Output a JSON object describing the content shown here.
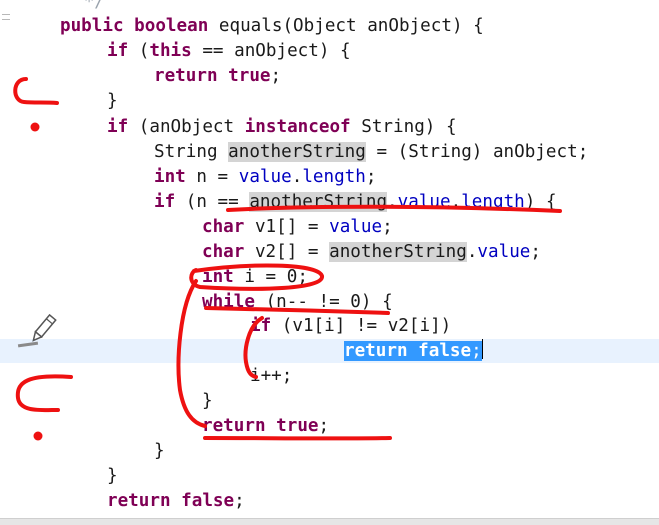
{
  "editor": {
    "top_fragment": "*/",
    "lines": [
      {
        "tokens": [
          {
            "t": "public ",
            "c": "kw"
          },
          {
            "t": "boolean ",
            "c": "kw"
          },
          {
            "t": "equals(Object anObject) {"
          }
        ]
      },
      {
        "tokens": [
          {
            "t": "if ",
            "c": "kw"
          },
          {
            "t": "("
          },
          {
            "t": "this",
            "c": "kw"
          },
          {
            "t": " == anObject) {"
          }
        ]
      },
      {
        "tokens": [
          {
            "t": "return ",
            "c": "kw"
          },
          {
            "t": "true",
            "c": "kw"
          },
          {
            "t": ";"
          }
        ]
      },
      {
        "tokens": [
          {
            "t": "}"
          }
        ]
      },
      {
        "tokens": [
          {
            "t": "if ",
            "c": "kw"
          },
          {
            "t": "(anObject "
          },
          {
            "t": "instanceof",
            "c": "kw"
          },
          {
            "t": " String) {"
          }
        ]
      },
      {
        "tokens": [
          {
            "t": "String "
          },
          {
            "t": "anotherString",
            "c": "occ"
          },
          {
            "t": " = (String) anObject;"
          }
        ]
      },
      {
        "tokens": [
          {
            "t": "int ",
            "c": "kw"
          },
          {
            "t": "n = "
          },
          {
            "t": "value",
            "c": "fld"
          },
          {
            "t": "."
          },
          {
            "t": "length",
            "c": "fld"
          },
          {
            "t": ";"
          }
        ]
      },
      {
        "tokens": [
          {
            "t": "if ",
            "c": "kw"
          },
          {
            "t": "(n == "
          },
          {
            "t": "anotherString",
            "c": "occ"
          },
          {
            "t": "."
          },
          {
            "t": "value",
            "c": "fld"
          },
          {
            "t": "."
          },
          {
            "t": "length",
            "c": "fld"
          },
          {
            "t": ") {"
          }
        ]
      },
      {
        "tokens": [
          {
            "t": "char ",
            "c": "kw"
          },
          {
            "t": "v1[] = "
          },
          {
            "t": "value",
            "c": "fld"
          },
          {
            "t": ";"
          }
        ]
      },
      {
        "tokens": [
          {
            "t": "char ",
            "c": "kw"
          },
          {
            "t": "v2[] = "
          },
          {
            "t": "anotherString",
            "c": "occ"
          },
          {
            "t": "."
          },
          {
            "t": "value",
            "c": "fld"
          },
          {
            "t": ";"
          }
        ]
      },
      {
        "tokens": [
          {
            "t": "int ",
            "c": "kw"
          },
          {
            "t": "i = 0;"
          }
        ]
      },
      {
        "tokens": [
          {
            "t": "while ",
            "c": "kw"
          },
          {
            "t": "(n-- != 0) {"
          }
        ]
      },
      {
        "tokens": [
          {
            "t": "if ",
            "c": "kw"
          },
          {
            "t": "(v1[i] != v2[i])"
          }
        ]
      },
      {
        "tokens": [
          {
            "t": "return ",
            "c": "kw sel"
          },
          {
            "t": "false",
            "c": "kw sel"
          },
          {
            "t": ";",
            "c": "sel"
          },
          {
            "t": "",
            "c": "caret"
          }
        ]
      },
      {
        "tokens": [
          {
            "t": "i++;"
          }
        ]
      },
      {
        "tokens": [
          {
            "t": "}"
          }
        ]
      },
      {
        "tokens": [
          {
            "t": "return ",
            "c": "kw"
          },
          {
            "t": "true",
            "c": "kw"
          },
          {
            "t": ";"
          }
        ]
      },
      {
        "tokens": [
          {
            "t": "}"
          }
        ]
      },
      {
        "tokens": [
          {
            "t": "}"
          }
        ]
      },
      {
        "tokens": [
          {
            "t": "return ",
            "c": "kw"
          },
          {
            "t": "false",
            "c": "kw"
          },
          {
            "t": ";"
          }
        ]
      }
    ]
  },
  "annotation_tool": {
    "icon": "pen-icon"
  },
  "colors": {
    "keyword": "#7f0055",
    "field": "#0000c0",
    "text": "#1a1a1a",
    "occurrence": "#d4d4d4",
    "selection": "#3399ff",
    "current_line": "#e8f2fe",
    "ink": "#ee1111"
  }
}
